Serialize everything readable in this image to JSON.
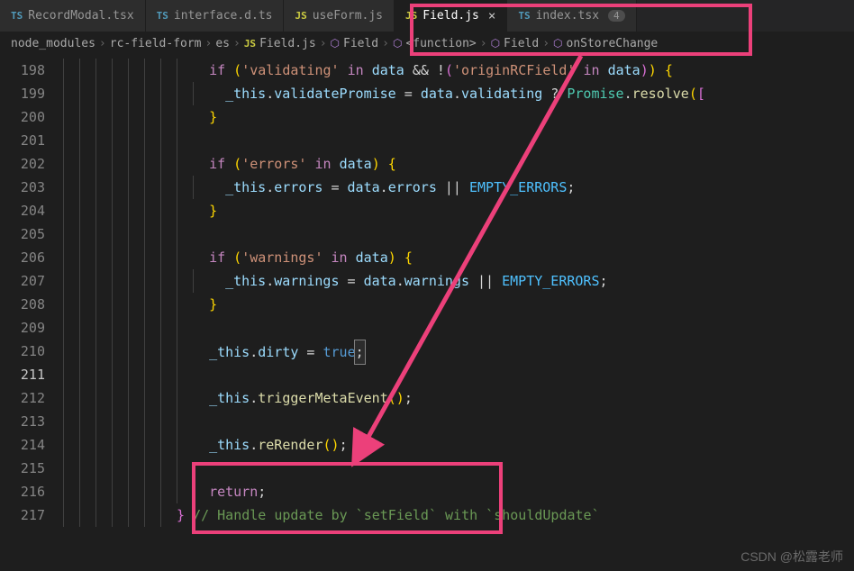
{
  "tabs": [
    {
      "icon": "TS",
      "iconClass": "ts-icon",
      "name": "RecordModal.tsx",
      "active": false
    },
    {
      "icon": "TS",
      "iconClass": "ts-icon",
      "name": "interface.d.ts",
      "active": false
    },
    {
      "icon": "JS",
      "iconClass": "js-icon",
      "name": "useForm.js",
      "active": false
    },
    {
      "icon": "JS",
      "iconClass": "js-icon",
      "name": "Field.js",
      "active": true,
      "closable": true
    },
    {
      "icon": "TS",
      "iconClass": "ts-icon",
      "name": "index.tsx",
      "active": false,
      "badge": "4"
    }
  ],
  "breadcrumb": {
    "items": [
      {
        "text": "node_modules"
      },
      {
        "text": "rc-field-form"
      },
      {
        "text": "es"
      },
      {
        "icon": "JS",
        "iconType": "js",
        "text": "Field.js"
      },
      {
        "icon": "◈",
        "iconType": "symbol",
        "text": "Field"
      },
      {
        "icon": "◈",
        "iconType": "symbol",
        "text": "<function>"
      },
      {
        "icon": "◈",
        "iconType": "symbol",
        "text": "Field"
      },
      {
        "icon": "◈",
        "iconType": "symbol",
        "text": "onStoreChange"
      }
    ]
  },
  "lineNumbers": [
    "198",
    "199",
    "200",
    "201",
    "202",
    "203",
    "204",
    "205",
    "206",
    "207",
    "208",
    "209",
    "210",
    "211",
    "212",
    "213",
    "214",
    "215",
    "216",
    "217"
  ],
  "currentLine": "211",
  "codeStrings": {
    "validating": "'validating'",
    "errors": "'errors'",
    "warnings": "'warnings'",
    "originRCField": "'originRCField'"
  },
  "identifiers": {
    "_this": "_this",
    "data": "data",
    "validatePromise": "validatePromise",
    "validating": "validating",
    "Promise": "Promise",
    "resolve": "resolve",
    "errors": "errors",
    "EMPTY_ERRORS": "EMPTY_ERRORS",
    "warnings": "warnings",
    "dirty": "dirty",
    "triggerMetaEvent": "triggerMetaEvent",
    "reRender": "reRender"
  },
  "keywords": {
    "if": "if",
    "in": "in",
    "return": "return",
    "true": "true"
  },
  "comment": "// Handle update by `setField` with `shouldUpdate`",
  "watermark": "CSDN @松露老师"
}
